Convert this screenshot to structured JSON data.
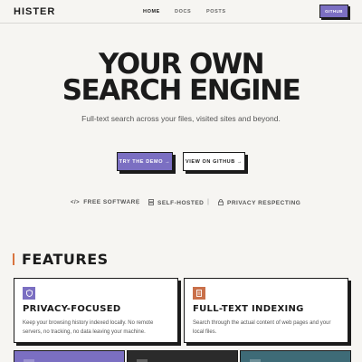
{
  "nav": {
    "logo": "HISTER",
    "links": [
      "HOME",
      "DOCS",
      "POSTS"
    ],
    "github": "GITHUB"
  },
  "hero": {
    "title_line1": "YOUR OWN",
    "title_line2": "SEARCH ENGINE",
    "subtitle": "Full-text search across your files, visited sites and beyond.",
    "btn_demo": "TRY THE DEMO →",
    "btn_github": "VIEW ON GITHUB →"
  },
  "badges": [
    {
      "icon": "code-icon",
      "label": "FREE SOFTWARE"
    },
    {
      "icon": "server-icon",
      "label": "SELF-HOSTED"
    },
    {
      "icon": "lock-icon",
      "label": "PRIVACY RESPECTING"
    }
  ],
  "features": {
    "heading": "FEATURES",
    "cards": [
      {
        "title": "PRIVACY-FOCUSED",
        "text": "Keep your browsing history indexed locally. No remote servers, no tracking, no data leaving your machine.",
        "icon": "shield-icon",
        "color": "#7b6fc2"
      },
      {
        "title": "FULL-TEXT INDEXING",
        "text": "Search through the actual content of web pages and your local files.",
        "icon": "document-icon",
        "color": "#c9704a"
      }
    ],
    "bottom_card_colors": [
      "#7b6fc2",
      "#2b2b2b",
      "#3e6b77"
    ]
  },
  "colors": {
    "accent": "#7b6fc2",
    "orange": "#d9743f",
    "background": "#f6f5f2"
  }
}
